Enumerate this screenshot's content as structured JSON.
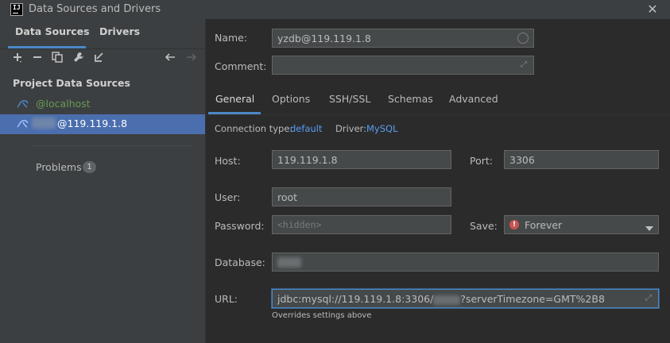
{
  "window": {
    "title": "Data Sources and Drivers",
    "close_glyph": "✕",
    "app_icon_text": "IJ"
  },
  "left": {
    "tabs": {
      "data_sources": "Data Sources",
      "drivers": "Drivers"
    },
    "toolbar": [
      "add-icon",
      "remove-icon",
      "duplicate-icon",
      "wrench-icon",
      "import-icon",
      "back-icon",
      "forward-icon"
    ],
    "group_title": "Project Data Sources",
    "items": [
      {
        "label": "@localhost"
      },
      {
        "label": "@119.119.1.8"
      }
    ],
    "problems": {
      "label": "Problems",
      "count": "1"
    }
  },
  "form": {
    "name_label": "Name:",
    "name_value": "yzdb@119.119.1.8",
    "comment_label": "Comment:",
    "comment_value": "",
    "tabs": [
      "General",
      "Options",
      "SSH/SSL",
      "Schemas",
      "Advanced"
    ],
    "connection_type_label": "Connection type:",
    "connection_type_value": "default",
    "driver_label": "Driver:",
    "driver_value": "MySQL",
    "host_label": "Host:",
    "host_value": "119.119.1.8",
    "port_label": "Port:",
    "port_value": "3306",
    "user_label": "User:",
    "user_value": "root",
    "password_label": "Password:",
    "password_placeholder": "<hidden>",
    "save_label": "Save:",
    "save_value": "Forever",
    "database_label": "Database:",
    "url_label": "URL:",
    "url_prefix": "jdbc:mysql://119.119.1.8:3306/",
    "url_suffix": "?serverTimezone=GMT%2B8",
    "url_hint": "Overrides settings above"
  },
  "colors": {
    "accent": "#4a88c7",
    "selection": "#4b6eaf",
    "link": "#589df6",
    "ok_green": "#6a9955",
    "error_red": "#c75450"
  }
}
